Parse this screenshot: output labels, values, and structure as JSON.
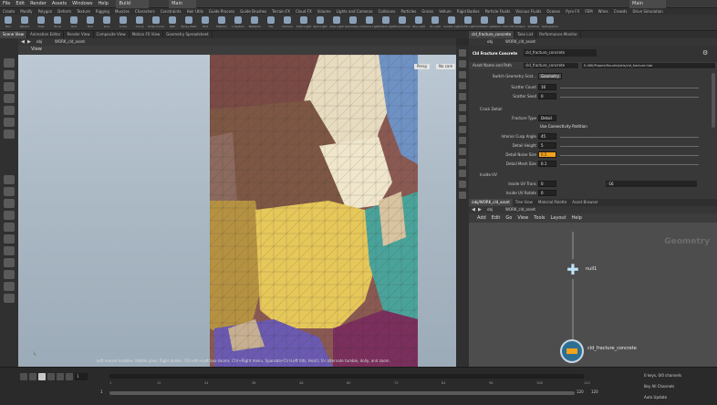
{
  "menubar": {
    "items": [
      "File",
      "Edit",
      "Render",
      "Assets",
      "Windows",
      "Help"
    ],
    "build": "Build",
    "desktop": "Main",
    "right": "Main"
  },
  "shelf_tabs": [
    "Create",
    "Modify",
    "Polygon",
    "Deform",
    "Texture",
    "Rigging",
    "Muscles",
    "Characters",
    "Constraints",
    "Hair Utils",
    "Guide Process",
    "Guide Brushes",
    "Terrain FX",
    "Cloud FX",
    "Volume",
    "Lights and Cameras",
    "Collisions",
    "Particles",
    "Grains",
    "Vellum",
    "Rigid Bodies",
    "Particle Fluids",
    "Viscous Fluids",
    "Oceans",
    "Pyro FX",
    "FEM",
    "Wires",
    "Crowds",
    "Drive Simulation"
  ],
  "shelf_tools": [
    "Box",
    "Sphere",
    "Tube",
    "Torus",
    "Grid",
    "Null",
    "Line",
    "Circle",
    "Curve",
    "Draw Curve",
    "Path",
    "Spray Paint",
    "Text",
    "Platonic",
    "L-System",
    "Metaball",
    "File",
    "Camera",
    "Point Light",
    "Spot Light",
    "Area Light",
    "Geometry Light",
    "Volume Light",
    "Distant Light",
    "Environment",
    "Sky Light",
    "GI Light",
    "Caustic Light",
    "Portal Light",
    "Ambient Light",
    "Stereo Camera",
    "VR Camera",
    "Switcher",
    "Gamepad Camera"
  ],
  "left_pane_tabs": [
    "Scene View",
    "Animation Editor",
    "Render View",
    "Composite View",
    "Motion FX View",
    "Geometry Spreadsheet"
  ],
  "vp_path": {
    "obj": "obj",
    "node": "WORK_cld_asset"
  },
  "viewport": {
    "title": "View",
    "persp": "Persp",
    "cam": "No cam",
    "status": "Left mouse tumbles. Middle pans. Right dollies. Ctrl+Alt+Left box-zooms. Ctrl+Right menu. Spacebar-Ctrl-Left tilts. Hold L for alternate tumble, dolly, and zoom."
  },
  "param_pane": {
    "tabs": [
      "cld_fracture_concrete",
      "Take List",
      "Performance Monitor"
    ],
    "path_obj": "obj",
    "path_node": "WORK_cld_asset",
    "node_type": "Cld Fracture Concrete",
    "node_name": "cld_fracture_concrete",
    "asset_name_label": "Asset Name and Path",
    "asset_name": "cld_fracture_concrete",
    "asset_path": "E:/WK/Project/Houdini/otls/cld_fracture.hda",
    "rows": [
      {
        "label": "Switch Geometry Scat...",
        "value": "Geometry"
      },
      {
        "label": "Scatter Count",
        "value": "16"
      },
      {
        "label": "Scatter Seed",
        "value": "0"
      },
      {
        "label": "Crack Detail",
        "value": ""
      },
      {
        "label": "Fracture Type",
        "value": "Detail"
      },
      {
        "label": "",
        "value": "Use Connectivity Partition"
      },
      {
        "label": "Interior Cusp Angle",
        "value": "45"
      },
      {
        "label": "Detail Height",
        "value": "5"
      },
      {
        "label": "Detail Noise Size",
        "value": "0.5"
      },
      {
        "label": "Detail Mesh Size",
        "value": "0.1"
      },
      {
        "label": "Inside UV",
        "value": ""
      },
      {
        "label": "Inside UV Trans",
        "value": "0"
      },
      {
        "label": "Inside UV Rotate",
        "value": "0"
      }
    ],
    "uv_trans_y": "-16"
  },
  "net_pane": {
    "tabs": [
      "/obj/WORK_cld_asset",
      "Tree View",
      "Material Palette",
      "Asset Browser"
    ],
    "path_obj": "obj",
    "path_node": "WORK_cld_asset",
    "menu": [
      "Add",
      "Edit",
      "Go",
      "View",
      "Tools",
      "Layout",
      "Help"
    ],
    "context_label": "Geometry",
    "nodes": [
      {
        "name": "null1"
      },
      {
        "name": "cld_fracture_concrete"
      }
    ]
  },
  "timeline": {
    "frame": "1",
    "start": "1",
    "end": "120",
    "end2": "120",
    "keys": "0 keys, 0/0 channels",
    "key_all": "Key All Channels",
    "auto_update": "Auto Update",
    "ticks": [
      "1",
      "12",
      "24",
      "36",
      "48",
      "60",
      "72",
      "84",
      "96",
      "108",
      "120"
    ]
  },
  "colors": {
    "viewport_bg": "#b0bfcc",
    "accent": "#f2a21c",
    "net_bg": "#4d4d4d"
  }
}
